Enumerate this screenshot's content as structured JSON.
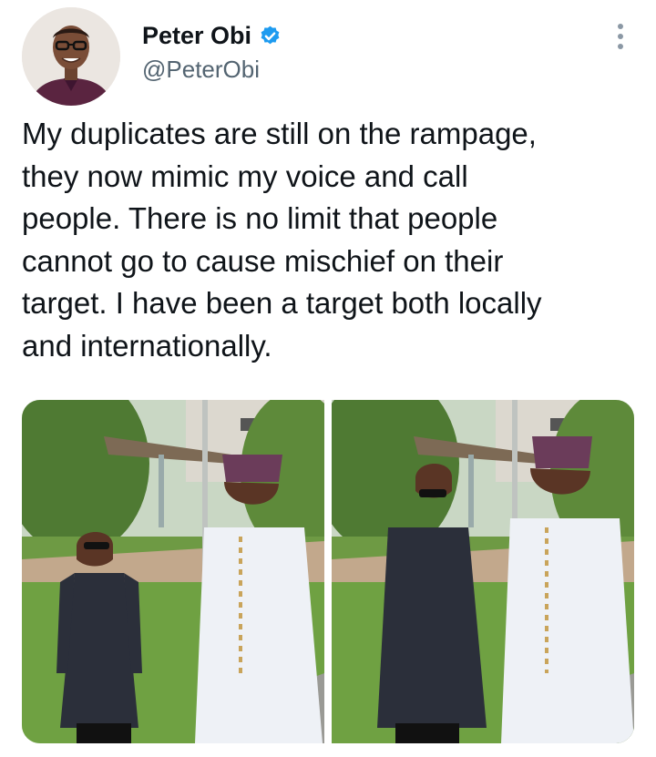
{
  "author": {
    "name": "Peter Obi",
    "handle": "@PeterObi",
    "verified_badge_icon": "verified-badge-icon",
    "avatar_icon": "profile-photo"
  },
  "tweet": {
    "text": "My duplicates are still on the rampage,\nthey now mimic my voice and call\npeople. There is no limit that people\ncannot go to cause mischief on their\ntarget. I have been a target both locally\nand internationally."
  },
  "media": {
    "photos": [
      {
        "icon": "photo-two-men-outdoors"
      },
      {
        "icon": "photo-two-men-outdoors"
      }
    ]
  },
  "colors": {
    "verified": "#1d9bf0",
    "handle": "#536471",
    "text": "#0f1419"
  }
}
